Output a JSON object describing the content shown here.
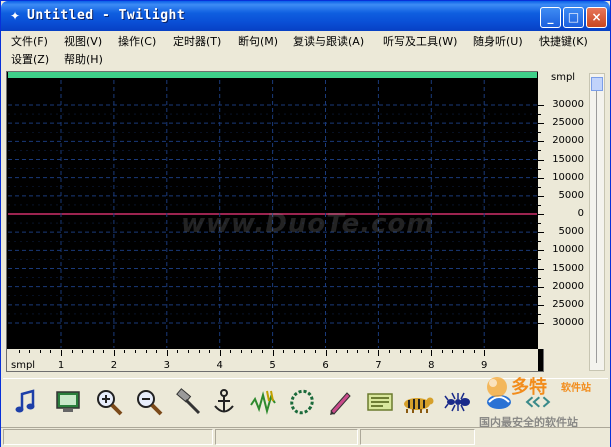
{
  "window": {
    "icon_name": "app-icon",
    "title": "Untitled - Twilight",
    "buttons": {
      "minimize": "_",
      "maximize": "□",
      "close": "×"
    }
  },
  "menu": [
    {
      "label": "文件(F)",
      "row": 0
    },
    {
      "label": "视图(V)",
      "row": 0
    },
    {
      "label": "操作(C)",
      "row": 0
    },
    {
      "label": "定时器(T)",
      "row": 0
    },
    {
      "label": "断句(M)",
      "row": 0
    },
    {
      "label": "复读与跟读(A)",
      "row": 0
    },
    {
      "label": "听写及工具(W)",
      "row": 0
    },
    {
      "label": "随身听(U)",
      "row": 0
    },
    {
      "label": "快捷键(K)",
      "row": 0
    },
    {
      "label": "设置(Z)",
      "row": 1
    },
    {
      "label": "帮助(H)",
      "row": 1
    }
  ],
  "scope": {
    "unit_label_right": "smpl",
    "unit_label_bottom": "smpl",
    "y_labels": [
      "30000",
      "25000",
      "20000",
      "15000",
      "10000",
      "5000",
      "0",
      "5000",
      "10000",
      "15000",
      "20000",
      "25000",
      "30000"
    ],
    "x_labels": [
      "1",
      "2",
      "3",
      "4",
      "5",
      "6",
      "7",
      "8",
      "9"
    ],
    "colors": {
      "background": "#000000",
      "grid": "#1a3a7a",
      "baseline": "#d0306a",
      "topbar": "#3fd08a"
    }
  },
  "toolbar": [
    {
      "name": "music-note-icon"
    },
    {
      "name": "monitor-icon"
    },
    {
      "name": "zoom-in-icon"
    },
    {
      "name": "zoom-out-icon"
    },
    {
      "name": "hammer-icon"
    },
    {
      "name": "anchor-icon"
    },
    {
      "name": "waveform-icon"
    },
    {
      "name": "loop-icon"
    },
    {
      "name": "pen-icon"
    },
    {
      "name": "text-panel-icon"
    },
    {
      "name": "tiger-icon"
    },
    {
      "name": "ant-icon"
    },
    {
      "name": "swirl-icon"
    },
    {
      "name": "arrows-icon"
    }
  ],
  "watermarks": {
    "center": "www.DuoTe.com",
    "logo_text": "多特",
    "logo_sub": "软件站",
    "logo_tag": "国内最安全的软件站"
  }
}
